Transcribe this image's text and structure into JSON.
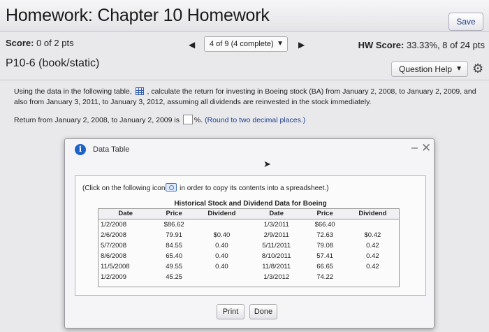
{
  "header": {
    "title": "Homework: Chapter 10 Homework",
    "save_label": "Save"
  },
  "status": {
    "score_label": "Score:",
    "score_value": "0 of 2 pts",
    "progress": "4 of 9 (4 complete)",
    "hw_score_label": "HW Score:",
    "hw_score_value": "33.33%, 8 of 24 pts"
  },
  "problem": {
    "id": "P10-6 (book/static)",
    "help_label": "Question Help",
    "instruction_part1": "Using the data in the following table,",
    "instruction_part2": ", calculate the return for investing in Boeing stock (BA) from January 2, 2008, to January 2, 2009, and also from January 3, 2011, to January 3, 2012, assuming all dividends are reinvested in the stock immediately.",
    "return_prompt": "Return from January 2, 2008, to January 2, 2009 is",
    "return_value": "",
    "percent_sign": "%.",
    "round_hint": "(Round to two decimal places.)"
  },
  "dialog": {
    "title": "Data Table",
    "copy_note_part1": "(Click on the following icon",
    "copy_note_part2": "in order to copy its contents into a spreadsheet.)",
    "caption": "Historical Stock and Dividend Data for Boeing",
    "headers": [
      "Date",
      "Price",
      "Dividend",
      "Date",
      "Price",
      "Dividend"
    ],
    "rows": [
      [
        "1/2/2008",
        "$86.62",
        "",
        "1/3/2011",
        "$66.40",
        ""
      ],
      [
        "2/6/2008",
        "79.91",
        "$0.40",
        "2/9/2011",
        "72.63",
        "$0.42"
      ],
      [
        "5/7/2008",
        "84.55",
        "0.40",
        "5/11/2011",
        "79.08",
        "0.42"
      ],
      [
        "8/6/2008",
        "65.40",
        "0.40",
        "8/10/2011",
        "57.41",
        "0.42"
      ],
      [
        "11/5/2008",
        "49.55",
        "0.40",
        "11/8/2011",
        "66.65",
        "0.42"
      ],
      [
        "1/2/2009",
        "45.25",
        "",
        "1/3/2012",
        "74.22",
        ""
      ]
    ],
    "print_label": "Print",
    "done_label": "Done"
  },
  "icons": {
    "prev": "◀",
    "next": "▶",
    "caret": "▼",
    "gear": "⚙",
    "info": "i",
    "minimize": "–",
    "close": "✕",
    "cursor": "➤"
  }
}
